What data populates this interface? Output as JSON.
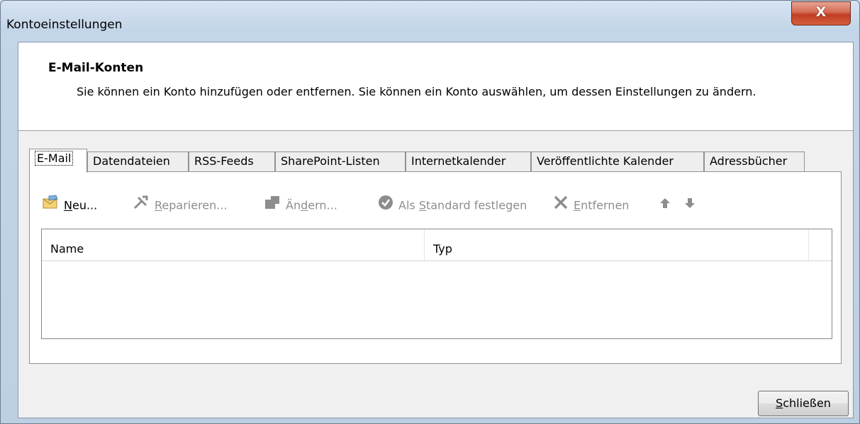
{
  "window": {
    "title": "Kontoeinstellungen",
    "close_glyph": "X"
  },
  "header": {
    "title": "E-Mail-Konten",
    "description": "Sie können ein Konto hinzufügen oder entfernen. Sie können ein Konto auswählen, um dessen Einstellungen zu ändern."
  },
  "tabs": [
    {
      "label": "E-Mail"
    },
    {
      "label": "Datendateien"
    },
    {
      "label": "RSS-Feeds"
    },
    {
      "label": "SharePoint-Listen"
    },
    {
      "label": "Internetkalender"
    },
    {
      "label": "Veröffentlichte Kalender"
    },
    {
      "label": "Adressbücher"
    }
  ],
  "toolbar": {
    "new": {
      "pre": "",
      "u": "N",
      "post": "eu..."
    },
    "repair": {
      "pre": "",
      "u": "R",
      "post": "eparieren..."
    },
    "change": {
      "pre": "Än",
      "u": "d",
      "post": "ern..."
    },
    "default": {
      "pre": "Als ",
      "u": "S",
      "post": "tandard festlegen"
    },
    "remove": {
      "pre": "",
      "u": "E",
      "post": "ntfernen"
    }
  },
  "list": {
    "columns": [
      "Name",
      "Typ"
    ]
  },
  "footer": {
    "close": {
      "pre": "",
      "u": "S",
      "post": "chließen"
    }
  }
}
